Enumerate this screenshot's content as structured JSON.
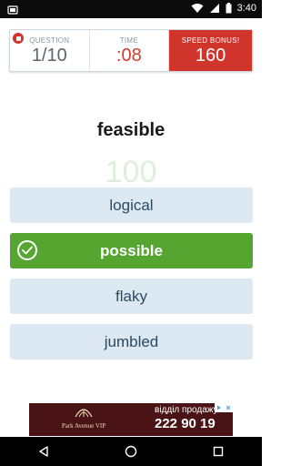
{
  "status_bar": {
    "time": "3:40",
    "icons": [
      "notification-icon",
      "wifi-icon",
      "signal-icon",
      "battery-icon"
    ]
  },
  "scorecard": {
    "question_label": "QUESTION",
    "question_value": "1/10",
    "time_label": "TIME",
    "time_value": ":08",
    "bonus_label": "SPEED BONUS!",
    "bonus_value": "160"
  },
  "quiz": {
    "word": "feasible",
    "points": "100",
    "options": [
      {
        "label": "logical",
        "state": "default"
      },
      {
        "label": "possible",
        "state": "correct"
      },
      {
        "label": "flaky",
        "state": "default"
      },
      {
        "label": "jumbled",
        "state": "default"
      }
    ]
  },
  "ad": {
    "brand": "Park Avenue VIP",
    "line1": "відділ продажу",
    "phone": "222 90 19"
  },
  "colors": {
    "correct": "#56a531",
    "option_bg": "#dde9f2",
    "bonus_bg": "#d0342a"
  }
}
